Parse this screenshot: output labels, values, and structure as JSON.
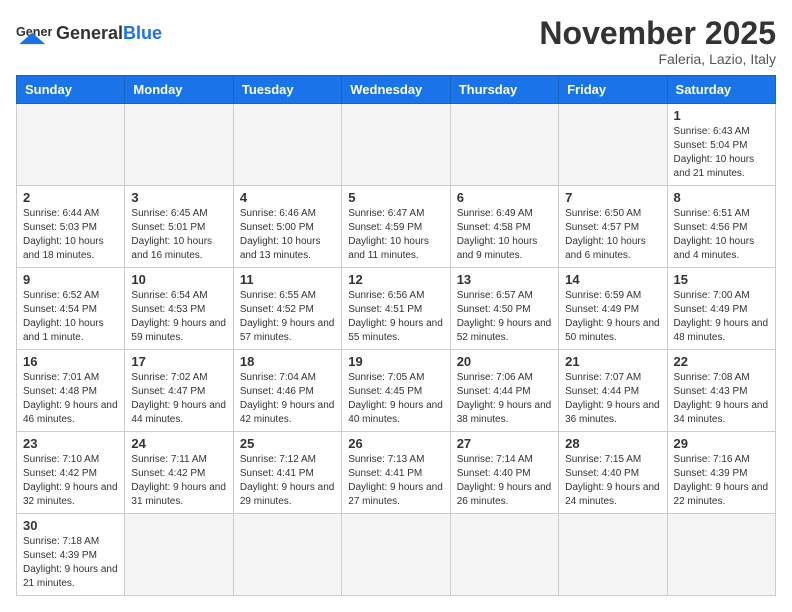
{
  "header": {
    "logo_general": "General",
    "logo_blue": "Blue",
    "month_title": "November 2025",
    "location": "Faleria, Lazio, Italy"
  },
  "days_of_week": [
    "Sunday",
    "Monday",
    "Tuesday",
    "Wednesday",
    "Thursday",
    "Friday",
    "Saturday"
  ],
  "weeks": [
    [
      {
        "day": "",
        "info": ""
      },
      {
        "day": "",
        "info": ""
      },
      {
        "day": "",
        "info": ""
      },
      {
        "day": "",
        "info": ""
      },
      {
        "day": "",
        "info": ""
      },
      {
        "day": "",
        "info": ""
      },
      {
        "day": "1",
        "info": "Sunrise: 6:43 AM\nSunset: 5:04 PM\nDaylight: 10 hours and 21 minutes."
      }
    ],
    [
      {
        "day": "2",
        "info": "Sunrise: 6:44 AM\nSunset: 5:03 PM\nDaylight: 10 hours and 18 minutes."
      },
      {
        "day": "3",
        "info": "Sunrise: 6:45 AM\nSunset: 5:01 PM\nDaylight: 10 hours and 16 minutes."
      },
      {
        "day": "4",
        "info": "Sunrise: 6:46 AM\nSunset: 5:00 PM\nDaylight: 10 hours and 13 minutes."
      },
      {
        "day": "5",
        "info": "Sunrise: 6:47 AM\nSunset: 4:59 PM\nDaylight: 10 hours and 11 minutes."
      },
      {
        "day": "6",
        "info": "Sunrise: 6:49 AM\nSunset: 4:58 PM\nDaylight: 10 hours and 9 minutes."
      },
      {
        "day": "7",
        "info": "Sunrise: 6:50 AM\nSunset: 4:57 PM\nDaylight: 10 hours and 6 minutes."
      },
      {
        "day": "8",
        "info": "Sunrise: 6:51 AM\nSunset: 4:56 PM\nDaylight: 10 hours and 4 minutes."
      }
    ],
    [
      {
        "day": "9",
        "info": "Sunrise: 6:52 AM\nSunset: 4:54 PM\nDaylight: 10 hours and 1 minute."
      },
      {
        "day": "10",
        "info": "Sunrise: 6:54 AM\nSunset: 4:53 PM\nDaylight: 9 hours and 59 minutes."
      },
      {
        "day": "11",
        "info": "Sunrise: 6:55 AM\nSunset: 4:52 PM\nDaylight: 9 hours and 57 minutes."
      },
      {
        "day": "12",
        "info": "Sunrise: 6:56 AM\nSunset: 4:51 PM\nDaylight: 9 hours and 55 minutes."
      },
      {
        "day": "13",
        "info": "Sunrise: 6:57 AM\nSunset: 4:50 PM\nDaylight: 9 hours and 52 minutes."
      },
      {
        "day": "14",
        "info": "Sunrise: 6:59 AM\nSunset: 4:49 PM\nDaylight: 9 hours and 50 minutes."
      },
      {
        "day": "15",
        "info": "Sunrise: 7:00 AM\nSunset: 4:49 PM\nDaylight: 9 hours and 48 minutes."
      }
    ],
    [
      {
        "day": "16",
        "info": "Sunrise: 7:01 AM\nSunset: 4:48 PM\nDaylight: 9 hours and 46 minutes."
      },
      {
        "day": "17",
        "info": "Sunrise: 7:02 AM\nSunset: 4:47 PM\nDaylight: 9 hours and 44 minutes."
      },
      {
        "day": "18",
        "info": "Sunrise: 7:04 AM\nSunset: 4:46 PM\nDaylight: 9 hours and 42 minutes."
      },
      {
        "day": "19",
        "info": "Sunrise: 7:05 AM\nSunset: 4:45 PM\nDaylight: 9 hours and 40 minutes."
      },
      {
        "day": "20",
        "info": "Sunrise: 7:06 AM\nSunset: 4:44 PM\nDaylight: 9 hours and 38 minutes."
      },
      {
        "day": "21",
        "info": "Sunrise: 7:07 AM\nSunset: 4:44 PM\nDaylight: 9 hours and 36 minutes."
      },
      {
        "day": "22",
        "info": "Sunrise: 7:08 AM\nSunset: 4:43 PM\nDaylight: 9 hours and 34 minutes."
      }
    ],
    [
      {
        "day": "23",
        "info": "Sunrise: 7:10 AM\nSunset: 4:42 PM\nDaylight: 9 hours and 32 minutes."
      },
      {
        "day": "24",
        "info": "Sunrise: 7:11 AM\nSunset: 4:42 PM\nDaylight: 9 hours and 31 minutes."
      },
      {
        "day": "25",
        "info": "Sunrise: 7:12 AM\nSunset: 4:41 PM\nDaylight: 9 hours and 29 minutes."
      },
      {
        "day": "26",
        "info": "Sunrise: 7:13 AM\nSunset: 4:41 PM\nDaylight: 9 hours and 27 minutes."
      },
      {
        "day": "27",
        "info": "Sunrise: 7:14 AM\nSunset: 4:40 PM\nDaylight: 9 hours and 26 minutes."
      },
      {
        "day": "28",
        "info": "Sunrise: 7:15 AM\nSunset: 4:40 PM\nDaylight: 9 hours and 24 minutes."
      },
      {
        "day": "29",
        "info": "Sunrise: 7:16 AM\nSunset: 4:39 PM\nDaylight: 9 hours and 22 minutes."
      }
    ],
    [
      {
        "day": "30",
        "info": "Sunrise: 7:18 AM\nSunset: 4:39 PM\nDaylight: 9 hours and 21 minutes."
      },
      {
        "day": "",
        "info": ""
      },
      {
        "day": "",
        "info": ""
      },
      {
        "day": "",
        "info": ""
      },
      {
        "day": "",
        "info": ""
      },
      {
        "day": "",
        "info": ""
      },
      {
        "day": "",
        "info": ""
      }
    ]
  ]
}
